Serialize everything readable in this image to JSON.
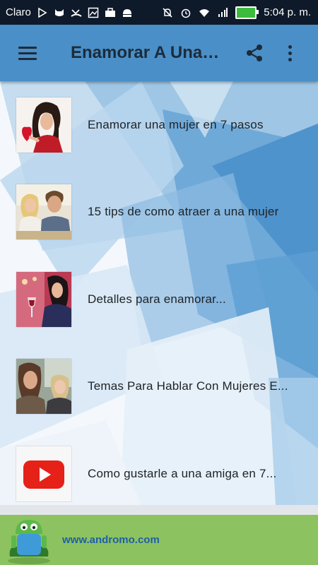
{
  "status_bar": {
    "carrier": "Claro",
    "time": "5:04 p. m.",
    "icons": [
      "play-store-icon",
      "cat-icon",
      "missed-call-icon",
      "image-icon",
      "briefcase-icon",
      "android-icon",
      "mute-icon",
      "alarm-icon",
      "wifi-icon",
      "signal-icon",
      "battery-charging-icon"
    ]
  },
  "app_bar": {
    "title": "Enamorar A Una Mujer",
    "icons": [
      "menu-icon",
      "share-icon",
      "more-vert-icon"
    ]
  },
  "list": {
    "items": [
      {
        "label": "Enamorar una mujer en 7 pasos",
        "thumb": "woman-with-heart-photo"
      },
      {
        "label": "15 tips de como atraer a una mujer",
        "thumb": "couple-photo"
      },
      {
        "label": "Detalles para enamorar...",
        "thumb": "woman-with-wine-photo"
      },
      {
        "label": "Temas Para Hablar Con Mujeres E...",
        "thumb": "women-talking-photo"
      },
      {
        "label": "Como gustarle a una amiga en 7...",
        "thumb": "youtube-icon"
      }
    ]
  },
  "ad": {
    "url": "www.andromo.com",
    "logo": "andromo-robot-logo"
  },
  "colors": {
    "status_bar": "#0e1a2a",
    "app_bar": "#4a8fc7",
    "ad_bar": "#8dc260",
    "youtube_red": "#e62117"
  }
}
